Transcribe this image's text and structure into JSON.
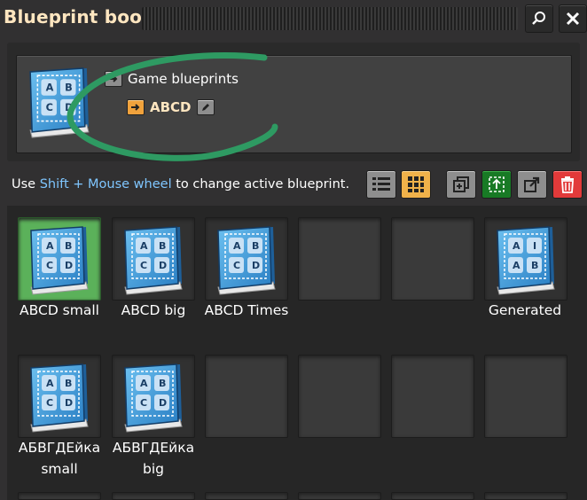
{
  "window": {
    "title": "Blueprint book",
    "search_icon": "search-icon",
    "close_icon": "close-icon"
  },
  "book_tree": {
    "root_label": "Game blueprints",
    "child_label": "ABCD"
  },
  "toolbar": {
    "hint_prefix": "Use ",
    "hint_key": "Shift + Mouse wheel",
    "hint_suffix": " to change active blueprint."
  },
  "slots": [
    {
      "label": "ABCD small",
      "letters": [
        "A",
        "B",
        "C",
        "D"
      ],
      "selected": true
    },
    {
      "label": "ABCD big",
      "letters": [
        "A",
        "B",
        "C",
        "D"
      ]
    },
    {
      "label": "ABCD Times",
      "letters": [
        "A",
        "B",
        "C",
        "D"
      ]
    },
    {
      "label": "",
      "letters": []
    },
    {
      "label": "",
      "letters": []
    },
    {
      "label": "Generated",
      "letters": [
        "A",
        "I",
        "A",
        "B"
      ]
    },
    {
      "label_line1": "АБВГДЕйка",
      "label_line2": "small",
      "letters": [
        "A",
        "B",
        "C",
        "D"
      ]
    },
    {
      "label_line1": "АБВГДЕйка",
      "label_line2": "big",
      "letters": [
        "A",
        "B",
        "C",
        "D"
      ]
    }
  ],
  "colors": {
    "title": "#ffe6c0",
    "hint_highlight": "#7fc6ff",
    "selected_slot": "#5bb15a",
    "active_view": "#f0b24a",
    "green_button": "#187a25",
    "red_button": "#e23a3a",
    "annotation_circle": "#2e9a62"
  }
}
